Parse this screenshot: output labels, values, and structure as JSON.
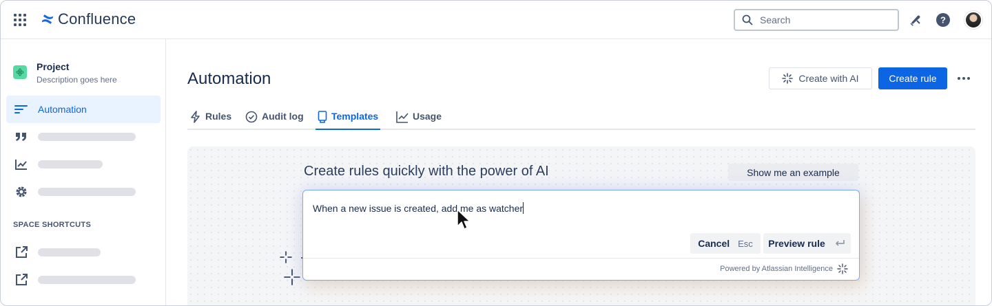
{
  "topnav": {
    "app_name": "Confluence",
    "search_placeholder": "Search",
    "brand_color": "#1868db"
  },
  "sidebar": {
    "project": {
      "title": "Project",
      "description": "Description goes here"
    },
    "items": [
      {
        "label": "Automation",
        "icon": "lines-icon",
        "active": true
      },
      {
        "label": "",
        "icon": "quote-icon"
      },
      {
        "label": "",
        "icon": "chart-icon"
      },
      {
        "label": "",
        "icon": "gear-icon"
      }
    ],
    "shortcuts_heading": "SPACE SHORTCUTS",
    "shortcuts": [
      {
        "label": "",
        "icon": "external-link-icon"
      },
      {
        "label": "",
        "icon": "external-link-icon"
      }
    ]
  },
  "main": {
    "title": "Automation",
    "create_with_ai_label": "Create with AI",
    "create_rule_label": "Create rule",
    "tabs": [
      {
        "label": "Rules",
        "icon": "bolt-icon"
      },
      {
        "label": "Audit log",
        "icon": "check-circle-icon"
      },
      {
        "label": "Templates",
        "icon": "template-icon",
        "active": true
      },
      {
        "label": "Usage",
        "icon": "trend-icon"
      }
    ],
    "ai_panel": {
      "heading": "Create rules quickly with the power of AI",
      "example_label": "Show me an example",
      "prompt_text": "When a new issue is created, add me as watcher",
      "cancel_label": "Cancel",
      "cancel_key": "Esc",
      "preview_label": "Preview rule",
      "powered_by": "Powered by Atlassian Intelligence"
    }
  },
  "colors": {
    "accent": "#0c66e4",
    "active_bg": "#e9f2ff",
    "text": "#172b4d"
  }
}
